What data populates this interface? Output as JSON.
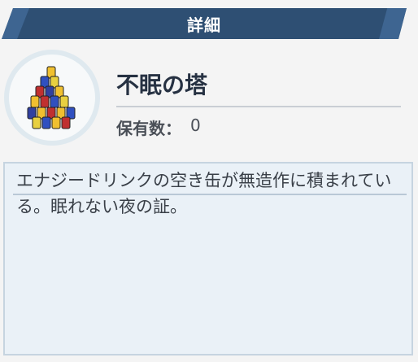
{
  "header": {
    "title": "詳細"
  },
  "item": {
    "icon": "energy-drink-can-tower-icon",
    "name": "不眠の塔",
    "owned_label": "保有数：",
    "owned_value": "0"
  },
  "description": {
    "text": "エナジードリンクの空き缶が無造作に積まれている。眠れない夜の証。"
  },
  "colors": {
    "header_bg": "#2e4f73",
    "header_accent": "#3e6591",
    "desc_bg": "#eaf1f7"
  }
}
